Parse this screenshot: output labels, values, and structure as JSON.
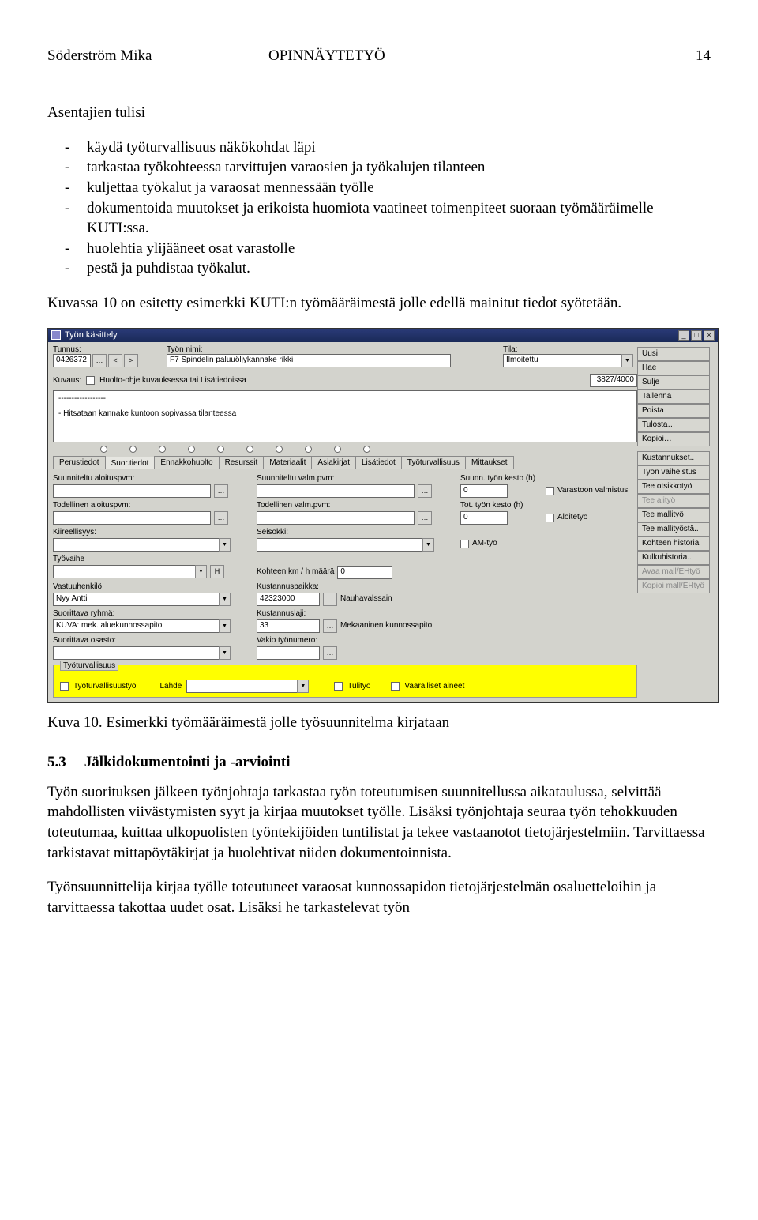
{
  "header": {
    "author": "Söderström Mika",
    "title": "OPINNÄYTETYÖ",
    "page": "14"
  },
  "intro": "Asentajien tulisi",
  "bullets": [
    "käydä työturvallisuus näkökohdat läpi",
    "tarkastaa työkohteessa tarvittujen varaosien ja työkalujen tilanteen",
    "kuljettaa työkalut ja varaosat mennessään työlle",
    "dokumentoida muutokset ja erikoista huomiota vaatineet toimenpiteet suoraan työmääräimelle KUTI:ssa.",
    "huolehtia ylijääneet osat varastolle",
    "pestä ja puhdistaa työkalut."
  ],
  "pre_image": "Kuvassa 10 on esitetty esimerkki KUTI:n työmääräimestä jolle edellä mainitut tiedot syötetään.",
  "app": {
    "title": "Työn käsittely",
    "tunnus_lbl": "Tunnus:",
    "tunnus_val": "0426372",
    "tyonimi_lbl": "Työn nimi:",
    "tyonimi_val": "F7 Spindelin paluuöljykannake rikki",
    "tila_lbl": "Tila:",
    "tila_val": "Ilmoitettu",
    "kuvaus_lbl": "Kuvaus:",
    "kuvaus_cb": "Huolto-ohje kuvauksessa tai Lisätiedoissa",
    "kuvaus_counter": "3827/4000",
    "kuvaus_dash": "------------------",
    "kuvaus_text": "- Hitsataan kannake kuntoon sopivassa tilanteessa",
    "tabs": [
      "Perustiedot",
      "Suor.tiedot",
      "Ennakkohuolto",
      "Resurssit",
      "Materiaalit",
      "Asiakirjat",
      "Lisätiedot",
      "Työturvallisuus",
      "Mittaukset"
    ],
    "suun_alo_pvm": "Suunniteltu aloituspvm:",
    "suun_valm_pvm": "Suunniteltu valm.pvm:",
    "suun_kesto": "Suunn. työn kesto (h)",
    "tod_alo_pvm": "Todellinen aloituspvm:",
    "tod_valm_pvm": "Todellinen valm.pvm:",
    "tot_kesto": "Tot. työn kesto (h)",
    "kesto_val": "0",
    "kesto_val2": "0",
    "var_valm": "Varastoon valmistus",
    "aloitetyo": "Aloitetyö",
    "amtyo": "AM-työ",
    "kiire": "Kiireellisyys:",
    "seisokki": "Seisokki:",
    "tyovaihe": "Työvaihe",
    "kohteen_km": "Kohteen km / h määrä",
    "km_val": "0",
    "vastuu": "Vastuuhenkilö:",
    "vastuu_val": "Nyy Antti",
    "kustpaikka": "Kustannuspaikka:",
    "kustpaikka_val": "42323000",
    "kustpaikka_text": "Nauhavalssain",
    "suor_ryhma": "Suorittava ryhmä:",
    "suor_ryhma_val": "KUVA: mek. aluekunnossapito",
    "kustlaji": "Kustannuslaji:",
    "kustlaji_val": "33",
    "kustlaji_text": "Mekaaninen kunnossapito",
    "suor_osasto": "Suorittava osasto:",
    "vakiono": "Vakio työnumero:",
    "ttv_title": "Työturvallisuus",
    "ttv_cb": "Työturvallisuustyö",
    "ttv_lahde": "Lähde",
    "ttv_tulityo": "Tulityö",
    "ttv_vaar": "Vaaralliset aineet",
    "buttons": {
      "uusi": "Uusi",
      "hae": "Hae",
      "sulje": "Sulje",
      "tallenna": "Tallenna",
      "poista": "Poista",
      "tulosta": "Tulosta…",
      "kopioi": "Kopioi…",
      "kust": "Kustannukset..",
      "vaihe": "Työn vaiheistus",
      "otsikko": "Tee otsikkotyö",
      "alityo": "Tee alityö",
      "mallityo": "Tee mallityö",
      "mallityosta": "Tee mallityöstä..",
      "kohist": "Kohteen historia",
      "kulku": "Kulkuhistoria..",
      "avaa": "Avaa mall/EHtyö",
      "kopmall": "Kopioi mall/EHtyö"
    }
  },
  "caption": "Kuva 10. Esimerkki työmääräimestä jolle työsuunnitelma kirjataan",
  "section_num": "5.3",
  "section_title": "Jälkidokumentointi ja -arviointi",
  "para1": "Työn suorituksen jälkeen työnjohtaja tarkastaa työn toteutumisen suunnitellussa aikataulussa, selvittää mahdollisten viivästymisten syyt ja kirjaa muutokset työlle. Lisäksi työnjohtaja seuraa työn tehokkuuden toteutumaa, kuittaa ulkopuolisten työntekijöiden tuntilistat ja tekee vastaanotot tietojärjestelmiin. Tarvittaessa tarkistavat mittapöytäkirjat ja huolehtivat niiden dokumentoinnista.",
  "para2": "Työnsuunnittelija kirjaa työlle toteutuneet varaosat kunnossapidon tietojärjestelmän osaluetteloihin ja tarvittaessa takottaa uudet osat. Lisäksi he tarkastelevat työn"
}
